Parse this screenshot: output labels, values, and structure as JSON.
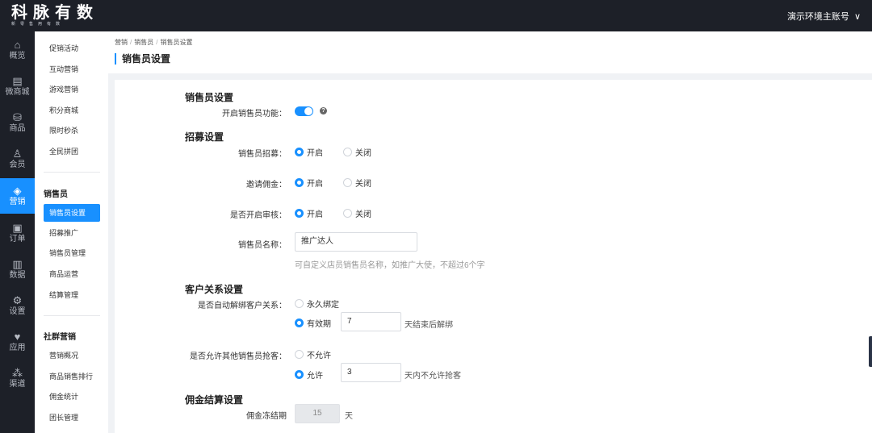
{
  "brand": {
    "logo_main": "科脉有数",
    "logo_sub": "新零售用有数"
  },
  "account": {
    "name": "演示环境主账号",
    "chevron_icon": "chevron-down-icon"
  },
  "rail": [
    {
      "icon": "home-icon",
      "glyph": "⌂",
      "label": "概览"
    },
    {
      "icon": "store-icon",
      "glyph": "▤",
      "label": "微商城"
    },
    {
      "icon": "bag-icon",
      "glyph": "⛁",
      "label": "商品"
    },
    {
      "icon": "basket-icon",
      "glyph": "♙",
      "label": "会员"
    },
    {
      "icon": "tag-icon",
      "glyph": "◈",
      "label": "营销"
    },
    {
      "icon": "order-icon",
      "glyph": "▣",
      "label": "订单"
    },
    {
      "icon": "chart-icon",
      "glyph": "▥",
      "label": "数据"
    },
    {
      "icon": "gear-icon",
      "glyph": "⚙",
      "label": "设置"
    },
    {
      "icon": "apps-icon",
      "glyph": "♥",
      "label": "应用"
    },
    {
      "icon": "channel-icon",
      "glyph": "⁂",
      "label": "渠道"
    }
  ],
  "submenu": {
    "top_items": [
      "促销活动",
      "互动营销",
      "游戏营销",
      "积分商城",
      "限时秒杀",
      "全民拼团"
    ],
    "group1_title": "销售员",
    "group1_items": [
      "销售员设置",
      "招募推广",
      "销售员管理",
      "商品运营",
      "结算管理"
    ],
    "group2_title": "社群营销",
    "group2_items": [
      "营销概况",
      "商品销售排行",
      "佣金统计",
      "团长管理"
    ]
  },
  "breadcrumb": {
    "items": [
      "营销",
      "销售员",
      "销售员设置"
    ],
    "separator": "/"
  },
  "page_title": "销售员设置",
  "form": {
    "sec_sales": "销售员设置",
    "enable_label": "开启销售员功能：",
    "help_icon": "help-icon",
    "help_glyph": "?",
    "sec_recruit": "招募设置",
    "recruit_label": "销售员招募：",
    "invite_label": "邀请佣金：",
    "audit_label": "是否开启审核：",
    "opt_on": "开启",
    "opt_off": "关闭",
    "name_label": "销售员名称：",
    "name_value": "推广达人",
    "name_hint": "可自定义店员销售员名称，如推广大使，不超过6个字",
    "sec_customer": "客户关系设置",
    "unbind_label": "是否自动解绑客户关系：",
    "opt_forever": "永久绑定",
    "opt_valid": "有效期",
    "valid_days": "7",
    "valid_suffix": "天结束后解绑",
    "steal_label": "是否允许其他销售员抢客：",
    "opt_disallow": "不允许",
    "opt_allow": "允许",
    "allow_days": "3",
    "allow_suffix": "天内不允许抢客",
    "sec_commission": "佣金结算设置",
    "freeze_label": "佣金冻结期",
    "freeze_value": "15",
    "freeze_unit": "天"
  },
  "colors": {
    "accent": "#1890ff",
    "dark": "#1d2028"
  }
}
